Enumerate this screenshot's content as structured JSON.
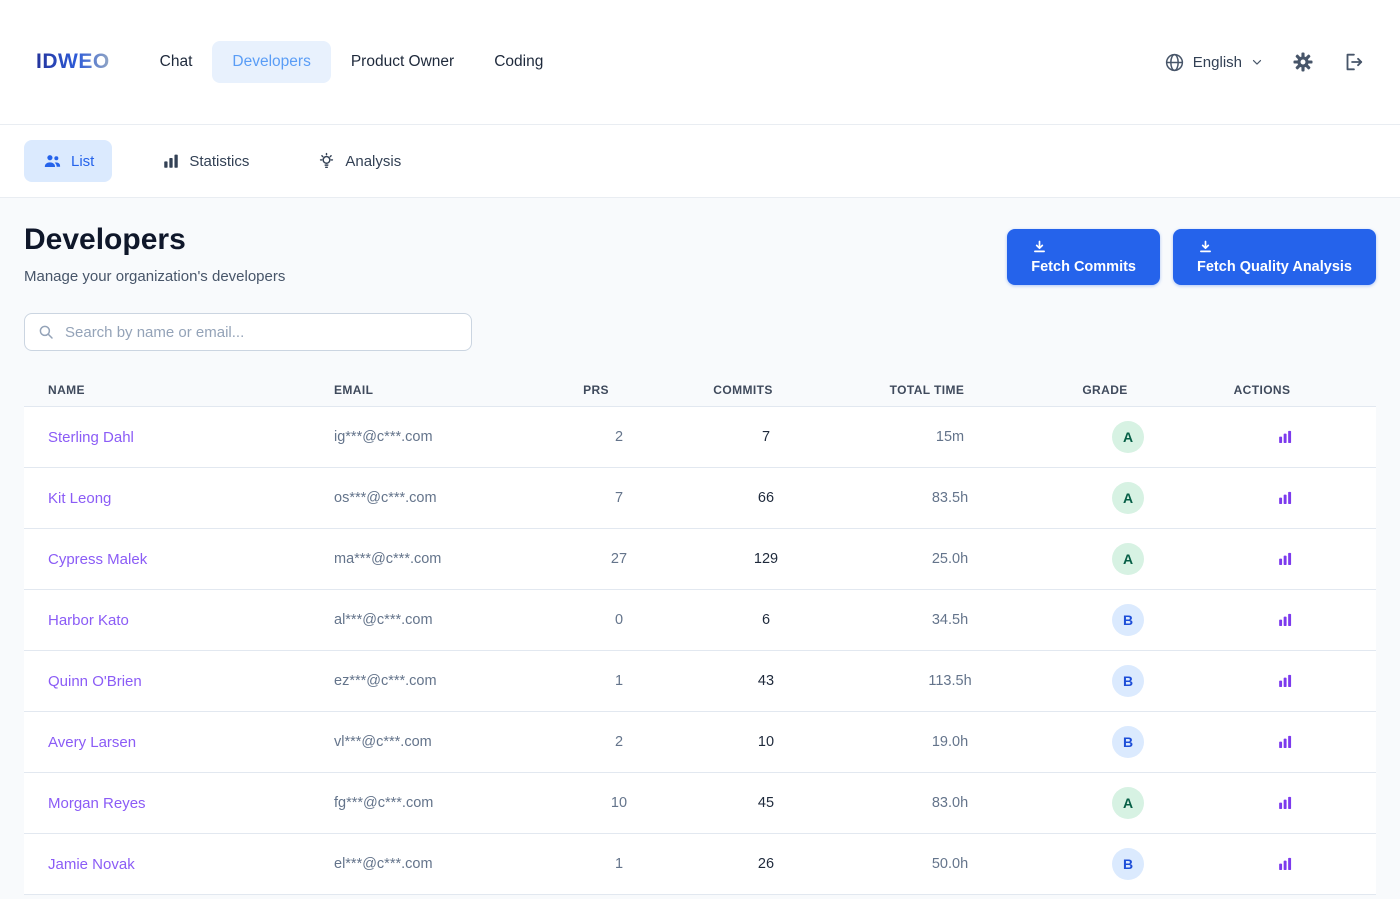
{
  "brand": {
    "logo": "IDWEO"
  },
  "navbar": {
    "items": [
      {
        "label": "Chat",
        "active": false
      },
      {
        "label": "Developers",
        "active": true
      },
      {
        "label": "Product Owner",
        "active": false
      },
      {
        "label": "Coding",
        "active": false
      }
    ],
    "language": {
      "label": "English",
      "icon": "globe-icon",
      "chevron": "chevron-down-icon"
    },
    "settings_icon": "gear-icon",
    "logout_icon": "logout-icon"
  },
  "subnav": {
    "tabs": [
      {
        "label": "List",
        "icon": "users-icon",
        "active": true
      },
      {
        "label": "Statistics",
        "icon": "bar-chart-icon",
        "active": false
      },
      {
        "label": "Analysis",
        "icon": "lightbulb-icon",
        "active": false
      }
    ]
  },
  "page": {
    "title": "Developers",
    "subtitle": "Manage your organization's developers"
  },
  "actions": {
    "fetch_commits_label": "Fetch Commits",
    "fetch_quality_label": "Fetch Quality Analysis",
    "icon": "download-icon"
  },
  "search": {
    "placeholder": "Search by name or email...",
    "value": "",
    "icon": "search-icon"
  },
  "table": {
    "columns": [
      "NAME",
      "EMAIL",
      "PRS",
      "COMMITS",
      "TOTAL TIME",
      "GRADE",
      "ACTIONS"
    ],
    "row_action_icon": "bar-chart-icon",
    "rows": [
      {
        "name": "Sterling Dahl",
        "email": "ig***@c***.com",
        "prs": 2,
        "commits": 7,
        "total_time": "15m",
        "grade": "A"
      },
      {
        "name": "Kit Leong",
        "email": "os***@c***.com",
        "prs": 7,
        "commits": 66,
        "total_time": "83.5h",
        "grade": "A"
      },
      {
        "name": "Cypress Malek",
        "email": "ma***@c***.com",
        "prs": 27,
        "commits": 129,
        "total_time": "25.0h",
        "grade": "A"
      },
      {
        "name": "Harbor Kato",
        "email": "al***@c***.com",
        "prs": 0,
        "commits": 6,
        "total_time": "34.5h",
        "grade": "B"
      },
      {
        "name": "Quinn O'Brien",
        "email": "ez***@c***.com",
        "prs": 1,
        "commits": 43,
        "total_time": "113.5h",
        "grade": "B"
      },
      {
        "name": "Avery Larsen",
        "email": "vl***@c***.com",
        "prs": 2,
        "commits": 10,
        "total_time": "19.0h",
        "grade": "B"
      },
      {
        "name": "Morgan Reyes",
        "email": "fg***@c***.com",
        "prs": 10,
        "commits": 45,
        "total_time": "83.0h",
        "grade": "A"
      },
      {
        "name": "Jamie Novak",
        "email": "el***@c***.com",
        "prs": 1,
        "commits": 26,
        "total_time": "50.0h",
        "grade": "B"
      }
    ]
  },
  "colors": {
    "primary_blue": "#2563eb",
    "active_nav_text": "#5a9df6",
    "active_nav_bg": "#e8f1fd",
    "active_tab_bg": "#dbeafe",
    "link_purple": "#8b5cf6",
    "action_icon_purple": "#7c3aed",
    "grade_a_bg": "#d7f2e3",
    "grade_a_text": "#065f46",
    "grade_b_bg": "#dbeafe",
    "grade_b_text": "#1d4ed8",
    "page_bg": "#f8fafc"
  }
}
